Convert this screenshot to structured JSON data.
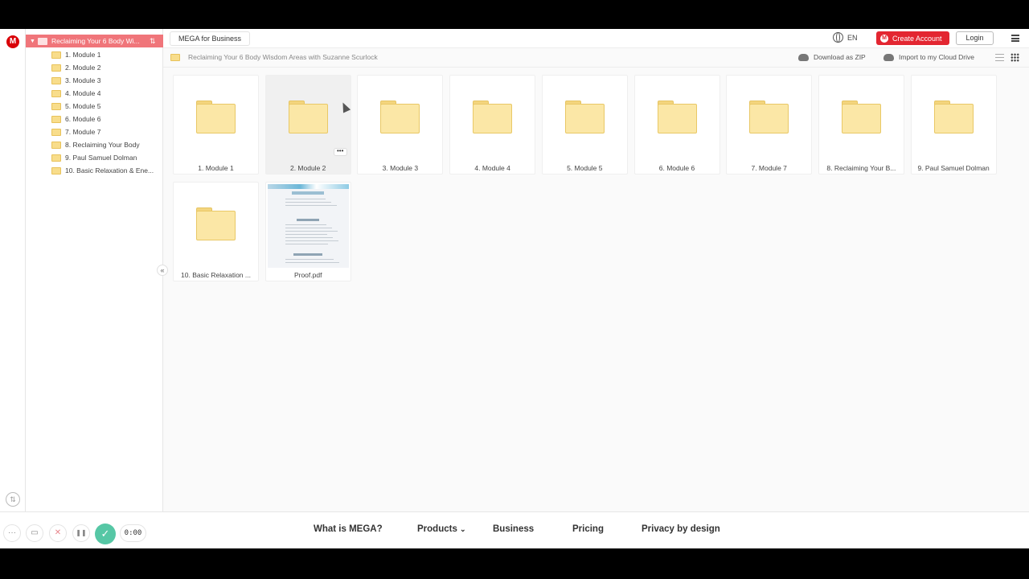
{
  "app": {
    "logo_letter": "M"
  },
  "tree": {
    "root_label": "Reclaiming Your 6 Body Wi...",
    "items": [
      "1. Module 1",
      "2. Module 2",
      "3. Module 3",
      "4. Module 4",
      "5. Module 5",
      "6. Module 6",
      "7. Module 7",
      "8. Reclaiming Your Body",
      "9. Paul Samuel Dolman",
      "10. Basic Relaxation & Ene..."
    ]
  },
  "topbar": {
    "business_tab": "MEGA for Business",
    "language": "EN",
    "create_account": "Create Account",
    "login": "Login"
  },
  "breadcrumb": {
    "path": "Reclaiming Your 6 Body Wisdom Areas with Suzanne Scurlock",
    "download_zip": "Download as ZIP",
    "import_cloud": "Import to my Cloud Drive"
  },
  "files": [
    {
      "name": "1. Module 1",
      "type": "folder"
    },
    {
      "name": "2. Module 2",
      "type": "folder",
      "hovered": true
    },
    {
      "name": "3. Module 3",
      "type": "folder"
    },
    {
      "name": "4. Module 4",
      "type": "folder"
    },
    {
      "name": "5. Module 5",
      "type": "folder"
    },
    {
      "name": "6. Module 6",
      "type": "folder"
    },
    {
      "name": "7. Module 7",
      "type": "folder"
    },
    {
      "name": "8. Reclaiming Your B...",
      "type": "folder"
    },
    {
      "name": "9. Paul Samuel Dolman",
      "type": "folder"
    },
    {
      "name": "10. Basic Relaxation ...",
      "type": "folder"
    },
    {
      "name": "Proof.pdf",
      "type": "pdf"
    }
  ],
  "more_button": "•••",
  "footer": {
    "nav": [
      "What is MEGA?",
      "Products",
      "Business",
      "Pricing",
      "Privacy by design"
    ],
    "products_caret": "⌄"
  },
  "recorder": {
    "more": "···",
    "camera": "▭",
    "cancel": "✕",
    "pause": "❚❚",
    "done": "✓",
    "time": "0:00"
  },
  "colors": {
    "brand_red": "#d90007",
    "tree_selected": "#f0757a",
    "folder_fill": "#fbe7a6",
    "recorder_green": "#56c7a5"
  }
}
